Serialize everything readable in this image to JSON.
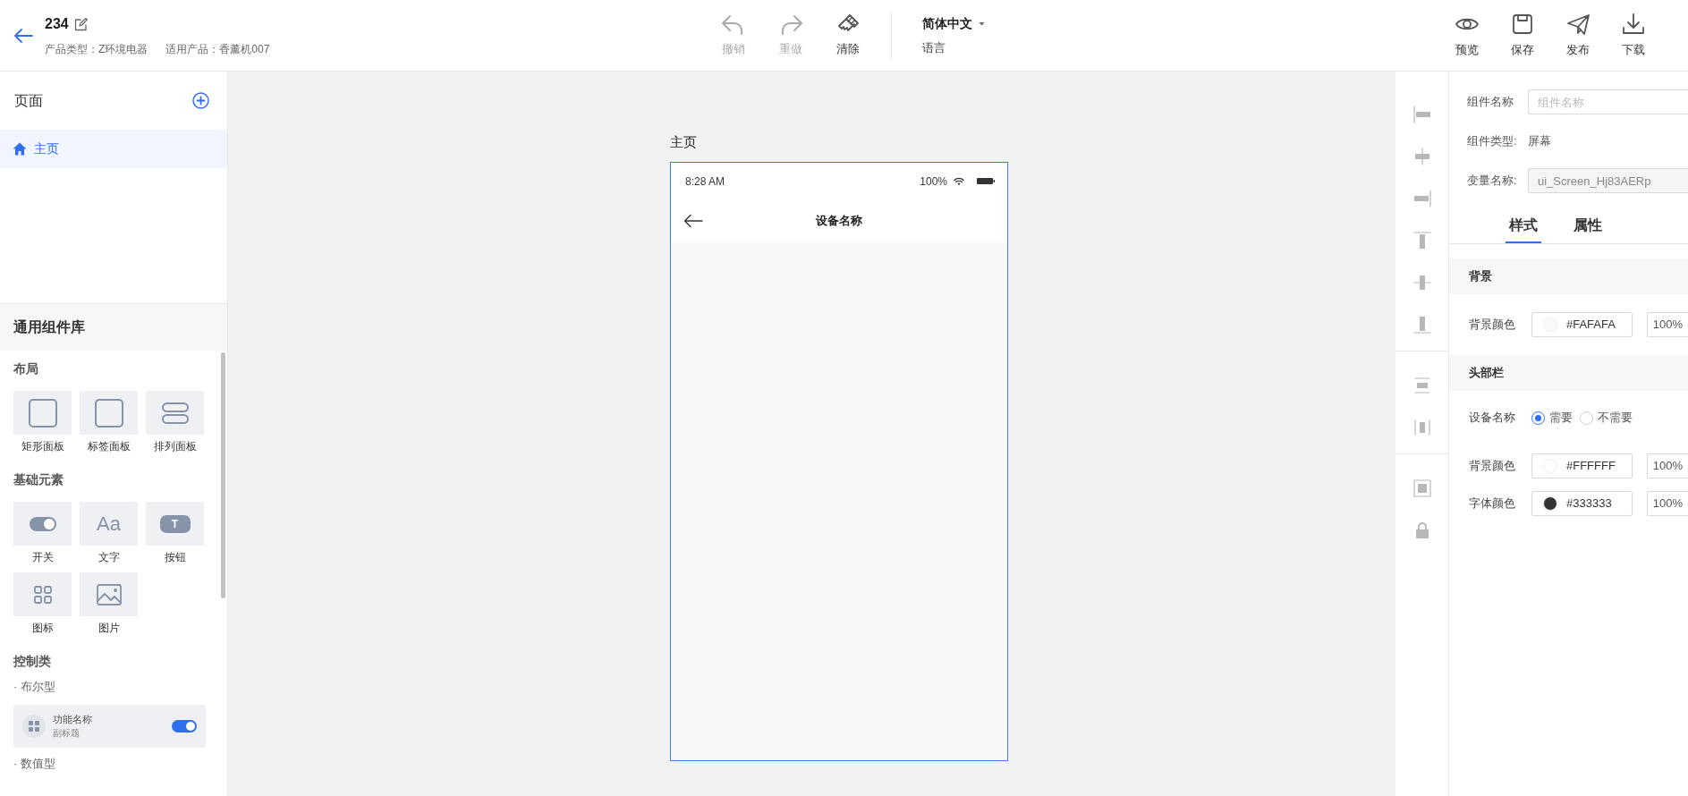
{
  "header": {
    "title": "234",
    "meta": [
      "产品类型：Z环境电器",
      "适用产品：香薰机007"
    ],
    "tools": [
      {
        "kind": "undo",
        "label": "撤销",
        "disabled": true
      },
      {
        "kind": "redo",
        "label": "重做",
        "disabled": true
      },
      {
        "kind": "clear",
        "label": "清除",
        "disabled": false
      }
    ],
    "language": {
      "value": "简体中文",
      "label": "语言"
    },
    "actions": [
      {
        "kind": "preview",
        "label": "预览"
      },
      {
        "kind": "save",
        "label": "保存"
      },
      {
        "kind": "publish",
        "label": "发布"
      },
      {
        "kind": "download",
        "label": "下载"
      }
    ]
  },
  "pages": {
    "title": "页面",
    "items": [
      {
        "label": "主页",
        "selected": true
      }
    ]
  },
  "library": {
    "title": "通用组件库",
    "groups": [
      {
        "title": "布局",
        "items": [
          {
            "kind": "rect",
            "label": "矩形面板"
          },
          {
            "kind": "rect",
            "label": "标签面板"
          },
          {
            "kind": "rows",
            "label": "排列面板"
          }
        ]
      },
      {
        "title": "基础元素",
        "items": [
          {
            "kind": "switch",
            "label": "开关"
          },
          {
            "kind": "glyph",
            "glyph": "Aa",
            "label": "文字"
          },
          {
            "kind": "pill",
            "glyph": "T",
            "label": "按钮"
          },
          {
            "kind": "grid",
            "label": "图标"
          },
          {
            "kind": "image",
            "label": "图片"
          }
        ]
      }
    ],
    "controls": {
      "title": "控制类",
      "subgroups": [
        {
          "title": "· 布尔型",
          "card": {
            "title": "功能名称",
            "subtitle": "副标题",
            "on": true
          }
        },
        {
          "title": "· 数值型"
        }
      ]
    }
  },
  "canvas": {
    "page_title": "主页",
    "phone": {
      "time": "8:28 AM",
      "battery": "100%",
      "nav_title": "设备名称"
    }
  },
  "properties": {
    "fields": [
      {
        "kind": "input",
        "label": "组件名称",
        "placeholder": "组件名称"
      },
      {
        "kind": "text",
        "label": "组件类型:",
        "value": "屏幕"
      },
      {
        "kind": "input",
        "label": "变量名称:",
        "value": "ui_Screen_Hj83AERp",
        "disabled": true
      }
    ],
    "tabs": [
      {
        "label": "样式",
        "selected": true
      },
      {
        "label": "属性",
        "selected": false
      }
    ],
    "sections": [
      {
        "title": "背景",
        "rows": [
          {
            "kind": "color",
            "label": "背景颜色",
            "color": "#fafafa",
            "value": "#FAFAFA",
            "opacity": "100%"
          }
        ]
      },
      {
        "title": "头部栏",
        "rows": [
          {
            "kind": "radio",
            "label": "设备名称",
            "options": [
              {
                "label": "需要",
                "selected": true
              },
              {
                "label": "不需要",
                "selected": false
              }
            ]
          },
          {
            "kind": "color",
            "label": "背景颜色",
            "color": "#ffffff",
            "value": "#FFFFFF",
            "opacity": "100%"
          },
          {
            "kind": "color",
            "label": "字体颜色",
            "color": "#333333",
            "value": "#333333",
            "opacity": "100%"
          }
        ]
      }
    ]
  }
}
